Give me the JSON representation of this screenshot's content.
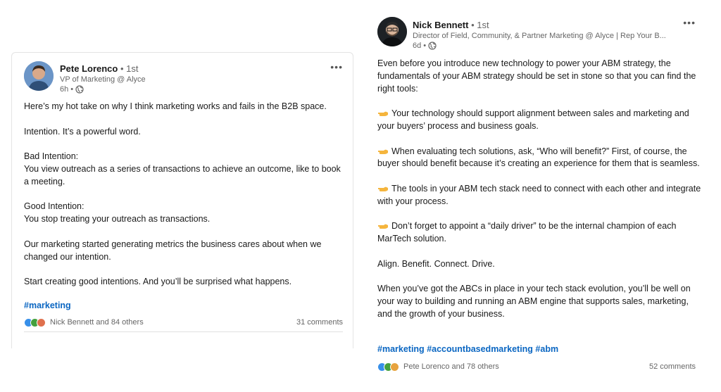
{
  "post1": {
    "author": "Pete Lorenco",
    "degree": "• 1st",
    "headline": "VP of Marketing @ Alyce",
    "time": "6h •",
    "more": "•••",
    "paragraphs": [
      "Here’s my hot take on why I think marketing works and fails in the B2B space.",
      "Intention. It’s a powerful word.",
      "Bad Intention:",
      "You view outreach as a series of transactions to achieve an outcome, like to book a meeting.",
      "Good Intention:",
      "You stop treating your outreach as transactions.",
      "Our marketing started generating metrics the business cares about when we changed our intention.",
      "Start creating good intentions. And you’ll be surprised what happens."
    ],
    "hashtags": [
      "#marketing"
    ],
    "reactions": "Nick Bennett and 84 others",
    "comments": "31 comments"
  },
  "post2": {
    "author": "Nick Bennett",
    "degree": "• 1st",
    "headline": "Director of Field, Community, & Partner Marketing @ Alyce | Rep Your B...",
    "time": "6d •",
    "more": "•••",
    "paragraphs": [
      "Even before you introduce new technology to power your ABM strategy, the fundamentals of your ABM strategy should be set in stone so that you can find the right tools:",
      "Your technology should support alignment between sales and marketing and your buyers’ process and business goals.",
      "When evaluating tech solutions, ask, “Who will benefit?” First, of course, the buyer should benefit because it’s creating an experience for them that is seamless.",
      "The tools in your ABM tech stack need to connect with each other and integrate with your process.",
      "Don’t forget to appoint a “daily driver” to be the internal champion of each MarTech solution.",
      "Align. Benefit. Connect. Drive.",
      "When you’ve got the ABCs in place in your tech stack evolution, you’ll be well on your way to building and running an ABM engine that supports sales, marketing, and the growth of your business."
    ],
    "hashtags": [
      "#marketing",
      "#accountbasedmarketing",
      "#abm"
    ],
    "reactions": "Pete Lorenco and 78 others",
    "comments": "52 comments"
  },
  "colors": {
    "link": "#0a66c2",
    "like": "#378fe9",
    "celebrate": "#44a03e",
    "love": "#df704d",
    "insight": "#e7a33e",
    "pointer": "#f5b53d"
  }
}
